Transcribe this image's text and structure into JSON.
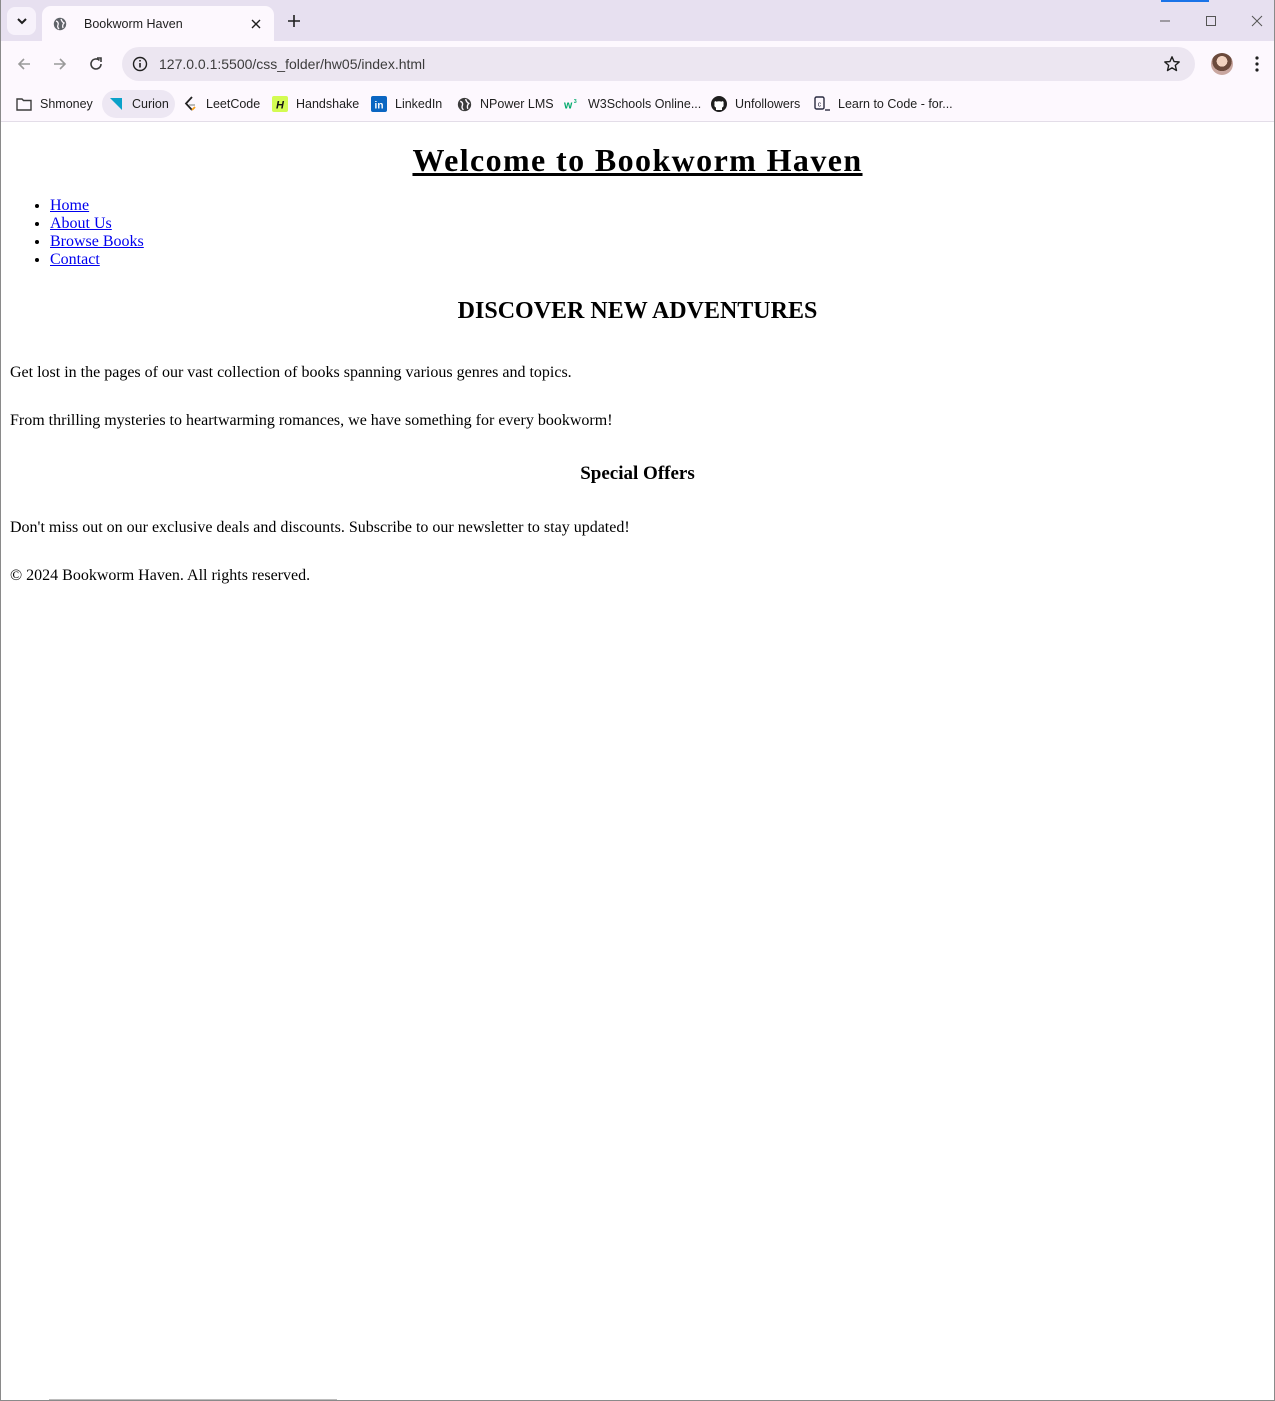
{
  "browser": {
    "tab": {
      "title": "Bookworm Haven",
      "favicon": "globe-icon"
    },
    "url": "127.0.0.1:5500/css_folder/hw05/index.html",
    "bookmarks": [
      {
        "label": "Shmoney",
        "icon": "folder-icon"
      },
      {
        "label": "Curion",
        "icon": "curion-logo-icon"
      },
      {
        "label": "LeetCode",
        "icon": "leetcode-icon"
      },
      {
        "label": "Handshake",
        "icon": "handshake-icon"
      },
      {
        "label": "LinkedIn",
        "icon": "linkedin-icon"
      },
      {
        "label": "NPower LMS",
        "icon": "globe-icon"
      },
      {
        "label": "W3Schools Online...",
        "icon": "w3schools-icon"
      },
      {
        "label": "Unfollowers",
        "icon": "github-icon"
      },
      {
        "label": "Learn to Code - for...",
        "icon": "freecodecamp-icon"
      }
    ],
    "colors": {
      "tabstrip": "#e7e0f0",
      "toolbar": "#fdf8fe",
      "omnibox": "#ece6f1",
      "link": "#0000ee"
    }
  },
  "page": {
    "title": "Welcome to Bookworm Haven",
    "nav": [
      "Home",
      "About Us",
      "Browse Books",
      "Contact"
    ],
    "section_heading": "DISCOVER NEW ADVENTURES",
    "paragraph1": "Get lost in the pages of our vast collection of books spanning various genres and topics.",
    "paragraph2": "From thrilling mysteries to heartwarming romances, we have something for every bookworm!",
    "offers_heading": "Special Offers",
    "offers_text": "Don't miss out on our exclusive deals and discounts. Subscribe to our newsletter to stay updated!",
    "footer": "© 2024 Bookworm Haven. All rights reserved."
  }
}
